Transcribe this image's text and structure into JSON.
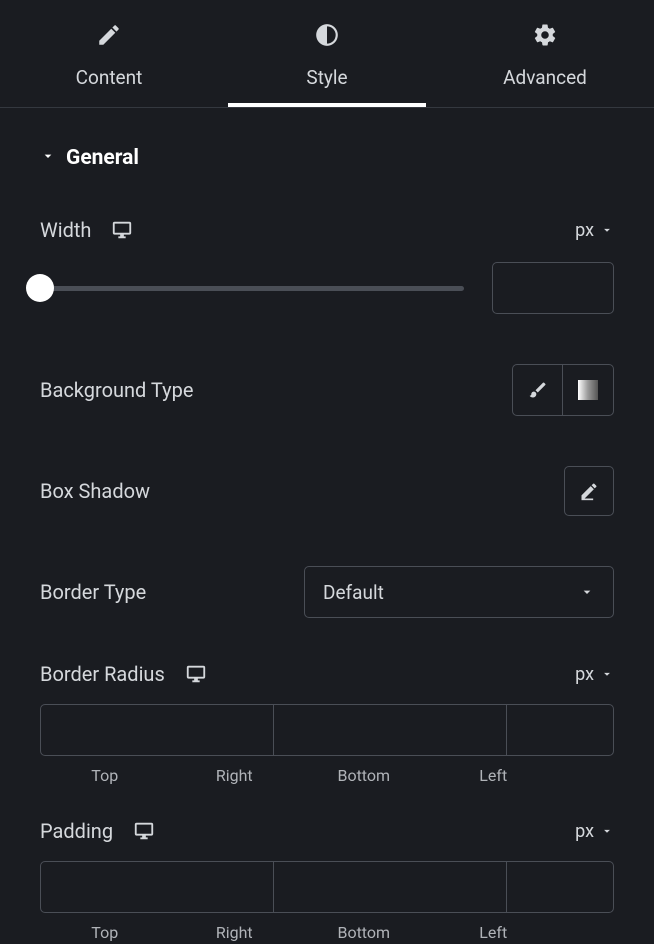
{
  "tabs": {
    "content": "Content",
    "style": "Style",
    "advanced": "Advanced"
  },
  "section": {
    "general_title": "General"
  },
  "width": {
    "label": "Width",
    "unit": "px",
    "value": ""
  },
  "background_type": {
    "label": "Background Type"
  },
  "box_shadow": {
    "label": "Box Shadow"
  },
  "border_type": {
    "label": "Border Type",
    "value": "Default"
  },
  "border_radius": {
    "label": "Border Radius",
    "unit": "px",
    "sides": {
      "top": "Top",
      "right": "Right",
      "bottom": "Bottom",
      "left": "Left"
    },
    "values": {
      "top": "",
      "right": "",
      "bottom": "",
      "left": ""
    }
  },
  "padding": {
    "label": "Padding",
    "unit": "px",
    "sides": {
      "top": "Top",
      "right": "Right",
      "bottom": "Bottom",
      "left": "Left"
    },
    "values": {
      "top": "",
      "right": "",
      "bottom": "",
      "left": ""
    }
  }
}
